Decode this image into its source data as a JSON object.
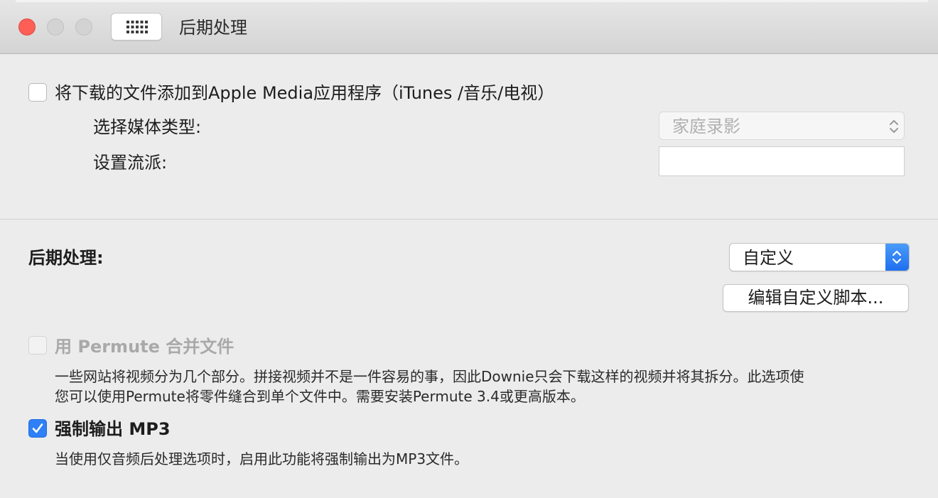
{
  "window": {
    "title": "后期处理"
  },
  "apple_media": {
    "checkbox_label": "将下载的文件添加到Apple Media应用程序（iTunes /音乐/电视）",
    "checked": false,
    "media_type_label": "选择媒体类型:",
    "media_type_value": "家庭录影",
    "genre_label": "设置流派:",
    "genre_value": ""
  },
  "post_processing": {
    "label": "后期处理:",
    "selected": "自定义",
    "edit_script_button": "编辑自定义脚本..."
  },
  "permute": {
    "checkbox_label": "用 Permute 合并文件",
    "enabled": false,
    "checked": false,
    "description_line1": "一些网站将视频分为几个部分。拼接视频并不是一件容易的事，因此Downie只会下载这样的视频并将其拆分。此选项使",
    "description_line2": "您可以使用Permute将零件缝合到单个文件中。需要安装Permute 3.4或更高版本。"
  },
  "force_mp3": {
    "checkbox_label": "强制输出 MP3",
    "checked": true,
    "description": "当使用仅音频后处理选项时，启用此功能将强制输出为MP3文件。"
  },
  "colors": {
    "accent": "#2f7ff6",
    "close": "#fd5f57"
  },
  "icons": {
    "toolbar_grid": "grid-icon",
    "check": "checkmark-icon",
    "chevron": "chevron-up-down-icon"
  }
}
